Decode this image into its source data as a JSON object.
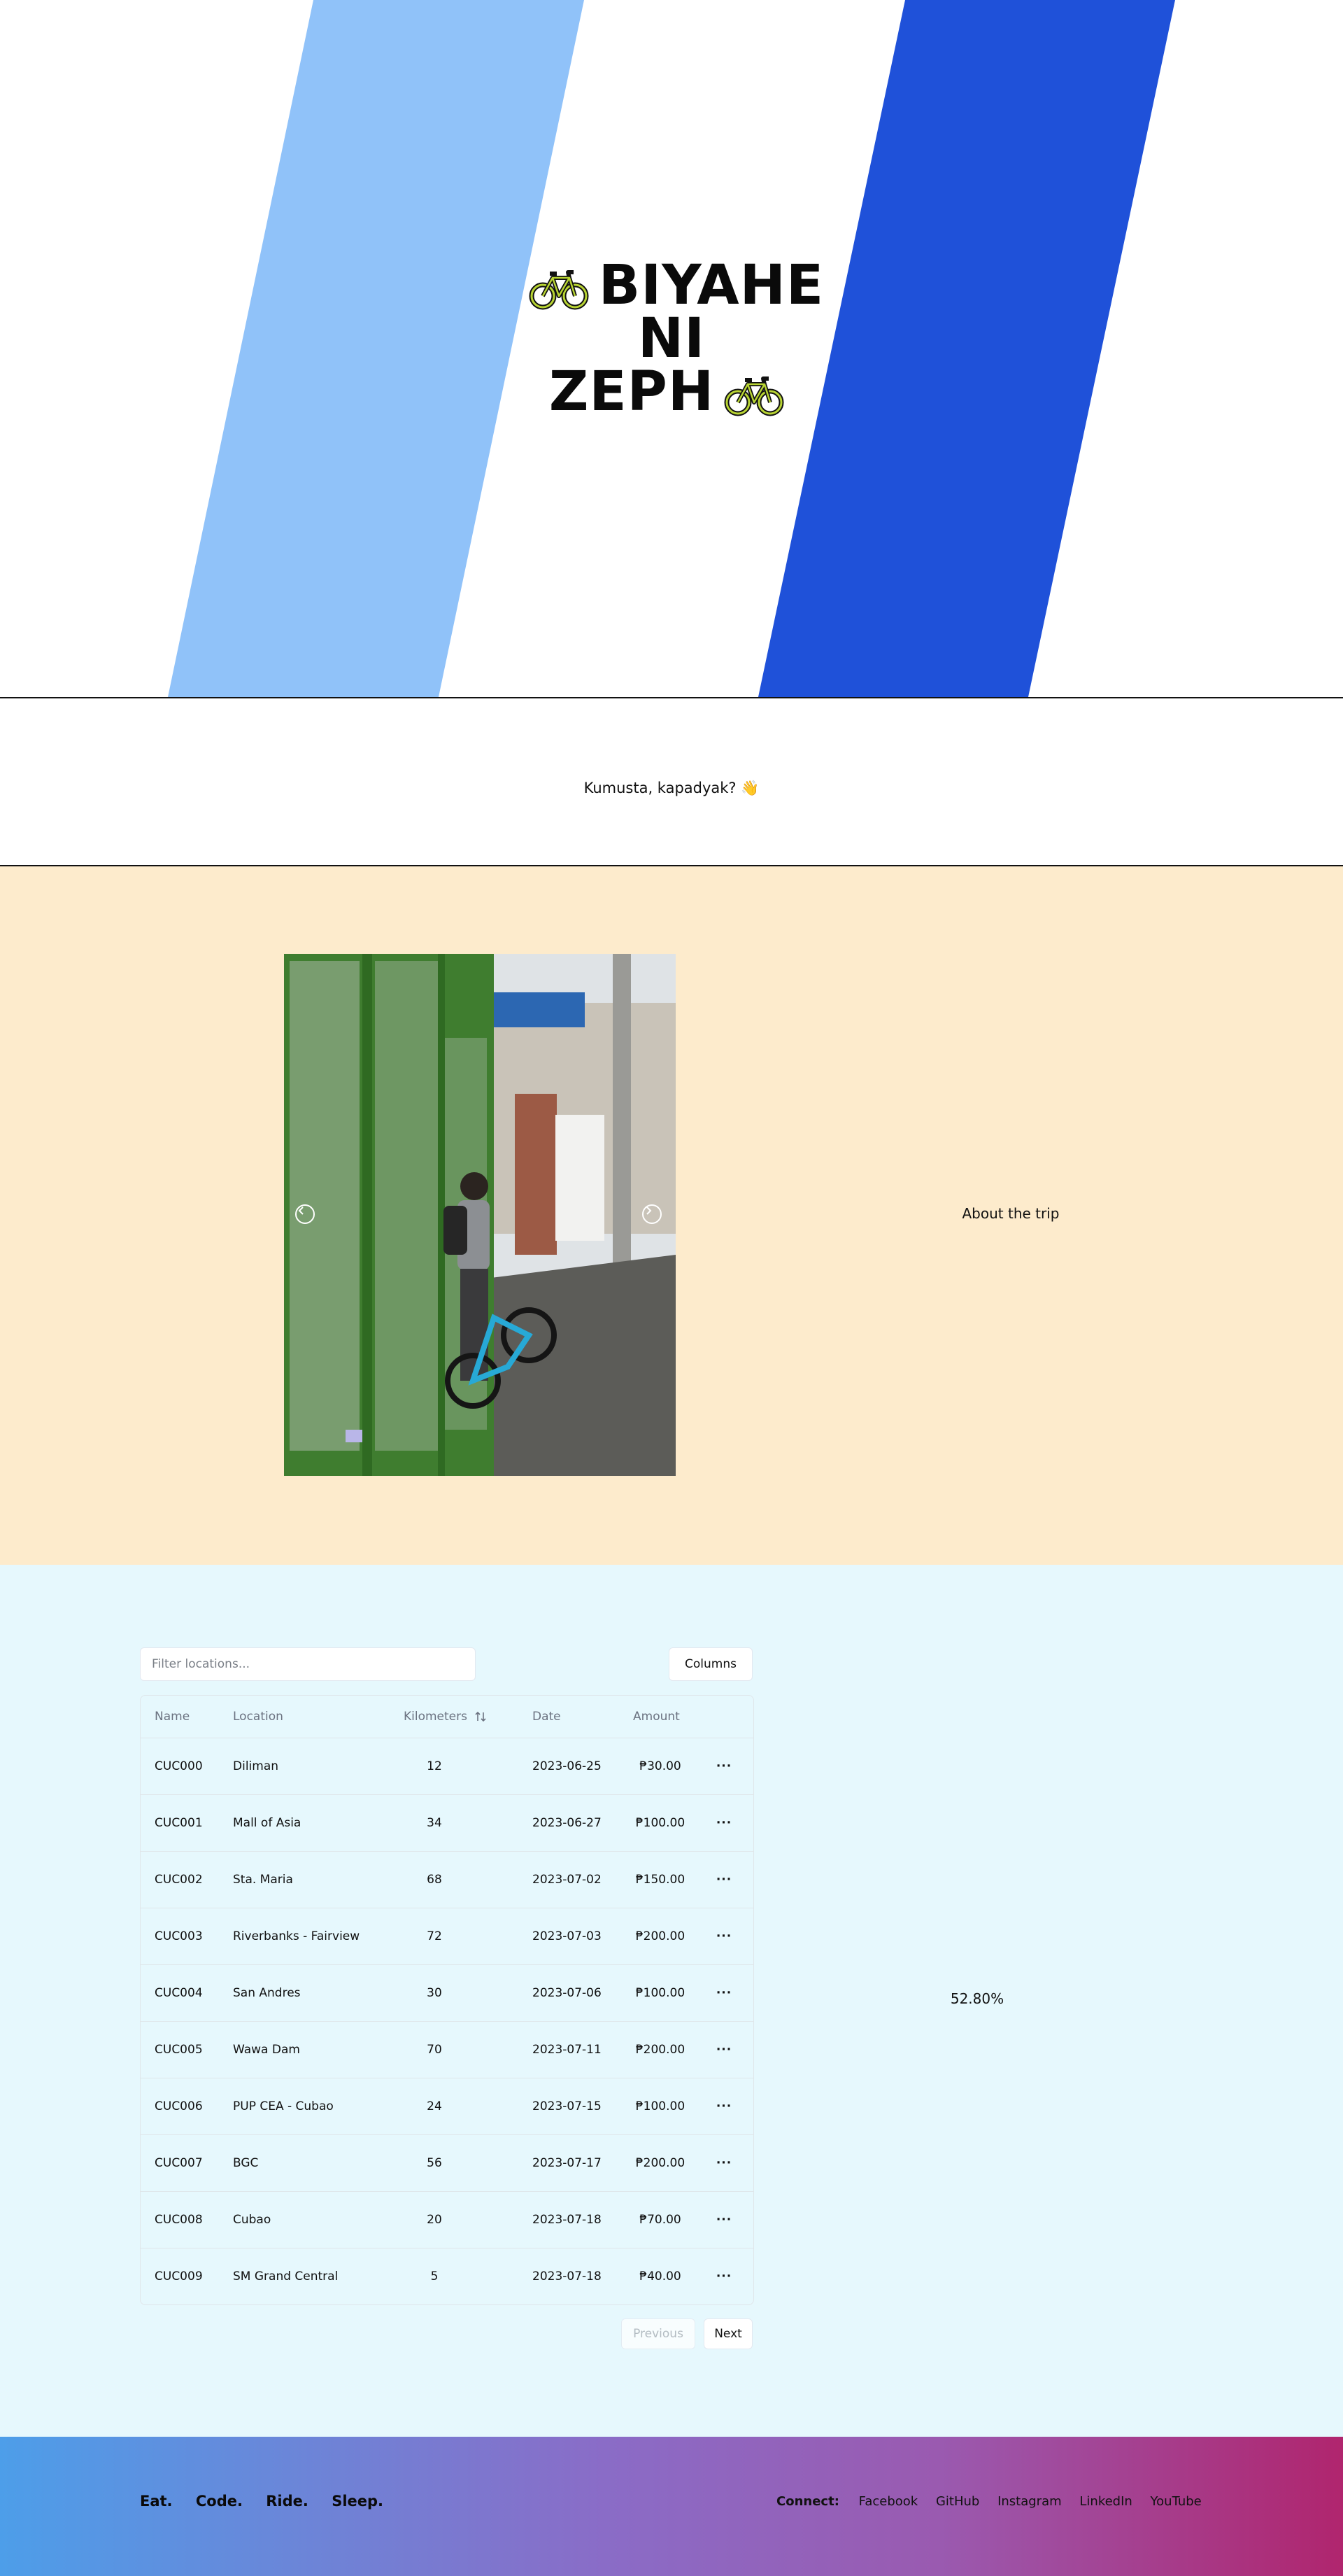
{
  "hero": {
    "title_line1": "BIYAHE",
    "title_line2": "NI",
    "title_line3": "ZEPH",
    "icons": [
      "bicycle-icon",
      "bicycle-icon"
    ],
    "colors": {
      "light_stripe": "#90c2f9",
      "dark_stripe": "#1f51d9",
      "background": "#ffffff"
    }
  },
  "greeting": {
    "text": "Kumusta, kapadyak? 👋"
  },
  "trip": {
    "about_label": "About the trip",
    "carousel": {
      "slide_count": 8,
      "active_index": 0,
      "prev_icon": "chevron-left-icon",
      "next_icon": "chevron-right-icon"
    },
    "colors": {
      "background": "#fdebcc"
    }
  },
  "table": {
    "filter_placeholder": "Filter locations...",
    "columns_button": "Columns",
    "headers": {
      "name": "Name",
      "location": "Location",
      "kilometers": "Kilometers",
      "date": "Date",
      "amount": "Amount"
    },
    "rows": [
      {
        "name": "CUC000",
        "location": "Diliman",
        "km": "12",
        "date": "2023-06-25",
        "amount": "₱30.00"
      },
      {
        "name": "CUC001",
        "location": "Mall of Asia",
        "km": "34",
        "date": "2023-06-27",
        "amount": "₱100.00"
      },
      {
        "name": "CUC002",
        "location": "Sta. Maria",
        "km": "68",
        "date": "2023-07-02",
        "amount": "₱150.00"
      },
      {
        "name": "CUC003",
        "location": "Riverbanks - Fairview",
        "km": "72",
        "date": "2023-07-03",
        "amount": "₱200.00"
      },
      {
        "name": "CUC004",
        "location": "San Andres",
        "km": "30",
        "date": "2023-07-06",
        "amount": "₱100.00"
      },
      {
        "name": "CUC005",
        "location": "Wawa Dam",
        "km": "70",
        "date": "2023-07-11",
        "amount": "₱200.00"
      },
      {
        "name": "CUC006",
        "location": "PUP CEA - Cubao",
        "km": "24",
        "date": "2023-07-15",
        "amount": "₱100.00"
      },
      {
        "name": "CUC007",
        "location": "BGC",
        "km": "56",
        "date": "2023-07-17",
        "amount": "₱200.00"
      },
      {
        "name": "CUC008",
        "location": "Cubao",
        "km": "20",
        "date": "2023-07-18",
        "amount": "₱70.00"
      },
      {
        "name": "CUC009",
        "location": "SM Grand Central",
        "km": "5",
        "date": "2023-07-18",
        "amount": "₱40.00"
      }
    ],
    "row_action_label": "···",
    "previous_label": "Previous",
    "next_label": "Next",
    "percent_text": "52.80%",
    "colors": {
      "background": "#e6f8fd"
    }
  },
  "footer": {
    "motto": [
      "Eat.",
      "Code.",
      "Ride.",
      "Sleep."
    ],
    "connect_label": "Connect:",
    "links": [
      "Facebook",
      "GitHub",
      "Instagram",
      "LinkedIn",
      "YouTube"
    ]
  }
}
